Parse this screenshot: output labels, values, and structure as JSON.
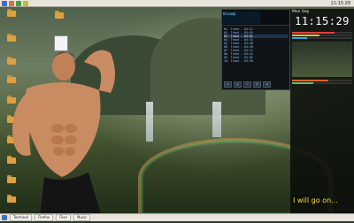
{
  "top_panel": {
    "clock": "11:15:29"
  },
  "player": {
    "lcd_title": "Winamp",
    "playlist": [
      "01. Track - 04:12",
      "02. Track - 03:45",
      "03. Track - 05:01",
      "04. Track - 04:33",
      "05. Track - 03:58",
      "06. Track - 04:20",
      "07. Track - 03:12",
      "08. Track - 05:44",
      "09. Track - 04:05",
      "10. Track - 03:30"
    ],
    "controls": [
      "|<",
      "||",
      ">",
      "[]",
      ">|"
    ]
  },
  "right_panel": {
    "header": "Mon Sep",
    "big_clock": "11:15:29",
    "footer": "I will go on..."
  },
  "taskbar": {
    "items": [
      "Terminal",
      "Firefox",
      "Files",
      "Music"
    ]
  }
}
